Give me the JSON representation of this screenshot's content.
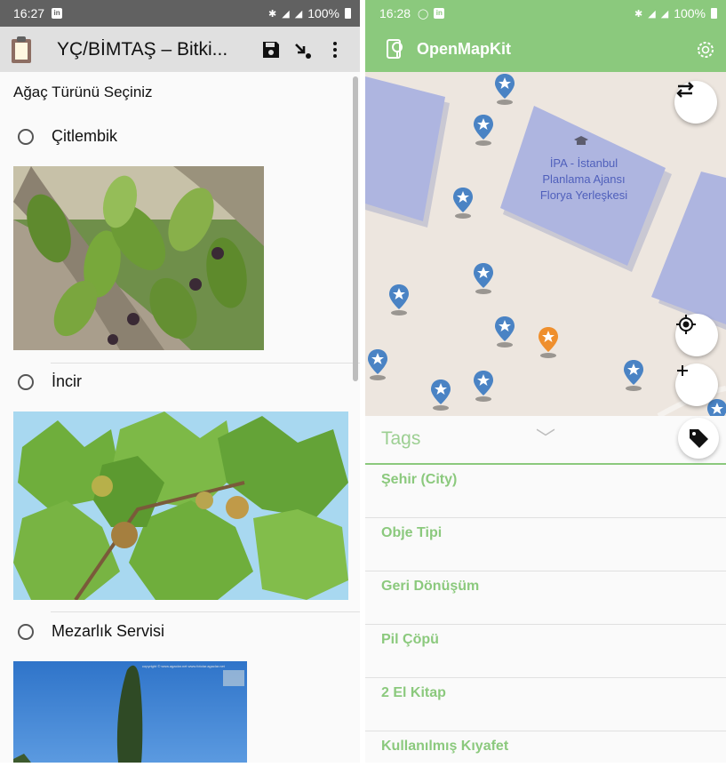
{
  "left": {
    "status": {
      "time": "16:27",
      "app_badge": "in",
      "battery": "100%"
    },
    "toolbar": {
      "title": "YÇ/BİMTAŞ – Bitki..."
    },
    "question": "Ağaç Türünü Seçiniz",
    "choices": [
      {
        "label": "Çitlembik"
      },
      {
        "label": "İncir"
      },
      {
        "label": "Mezarlık Servisi"
      }
    ],
    "image_caption": "copyright © www.agaclar.net  www.fotolar.agaclar.net"
  },
  "right": {
    "status": {
      "time": "16:28",
      "battery": "100%"
    },
    "toolbar": {
      "title": "OpenMapKit"
    },
    "map": {
      "building_label": "İPA - İstanbul Planlama Ajansı Florya Yerleşkesi",
      "marker_colors": {
        "default": "#4a83c4",
        "selected": "#ef8f2d"
      }
    },
    "tags": {
      "title": "Tags",
      "items": [
        "Şehir (City)",
        "Obje Tipi",
        "Geri Dönüşüm",
        "Pil Çöpü",
        "2 El Kitap",
        "Kullanılmış Kıyafet"
      ]
    },
    "accent_color": "#8bc97d"
  }
}
